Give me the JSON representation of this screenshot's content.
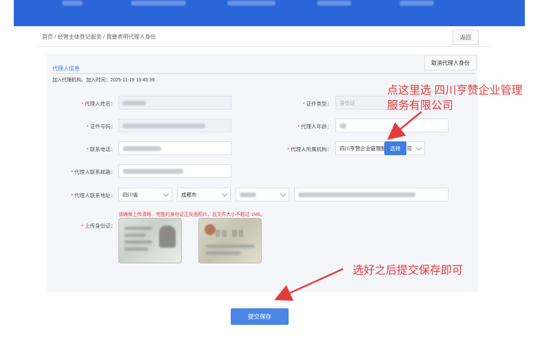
{
  "breadcrumb": "首页 / 经营主体登记服务 / 我要表明代理人身份",
  "back_label": "返回",
  "cancel_agent_label": "取消代理人身份",
  "section_title": "代理人信息",
  "add_info": "加入代理机构、加入时间：2025-11-19 13:45:39",
  "fields": {
    "name_label": "代理人姓名：",
    "cert_type_label": "证件类型：",
    "cert_type_value": "身份证",
    "cert_no_label": "证件号码：",
    "age_label": "代理人年龄：",
    "phone_label": "联系电话：",
    "org_label": "代理人所属机构：",
    "org_value": "四川亨赞企业管理服务有限公司",
    "email_label": "代理人联系邮箱：",
    "address_label": "代理人联系地址：",
    "province_value": "四川省",
    "city_value": "成都市",
    "upload_label": "上传身份证："
  },
  "select_button_label": "选择",
  "upload_tip": "请确保上传清晰、完整的身份证正反面照片，且文件大小不超过 1MB。",
  "submit_label": "提交保存",
  "annotations": {
    "top": "点这里选 四川亨赞企业管理服务有限公司",
    "bottom": "选好之后提交保存即可"
  },
  "colors": {
    "nav": "#2b66d9",
    "accent": "#3f7de3",
    "required": "#e23b3b",
    "annotation": "#e23b3b"
  }
}
